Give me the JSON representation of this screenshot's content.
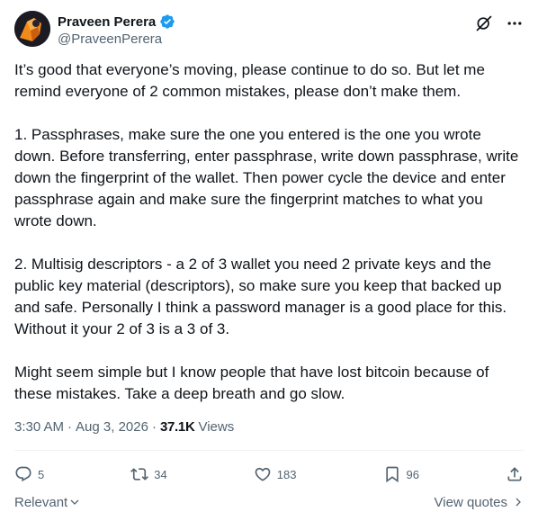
{
  "author": {
    "display_name": "Praveen Perera",
    "handle": "@PraveenPerera",
    "verified": true
  },
  "header_actions": {
    "grok_icon": "grok-icon",
    "more_icon": "more-icon"
  },
  "tweet": {
    "paragraphs": [
      "It’s good that everyone’s moving, please continue to do so. But let me remind everyone of 2 common mistakes, please don’t make them.",
      "1. Passphrases, make sure the one you entered is the one you wrote down. Before transferring, enter passphrase, write down passphrase, write down the fingerprint of the wallet. Then power cycle the device and enter passphrase again and make sure the fingerprint matches to what you wrote down.",
      "2. Multisig descriptors - a 2 of 3 wallet you need 2 private keys and the public key material (descriptors), so make sure you keep that backed up and safe. Personally I think a password manager is a good place for this. Without it your 2 of 3 is a 3 of 3.",
      "Might seem simple but I know people that have lost bitcoin because of these mistakes. Take a deep breath and go slow."
    ]
  },
  "meta": {
    "time": "3:30 AM",
    "date": "Aug 3, 2026",
    "separator": "·",
    "views_count": "37.1K",
    "views_label": "Views"
  },
  "actions": {
    "replies": "5",
    "reposts": "34",
    "likes": "183",
    "bookmarks": "96"
  },
  "footer": {
    "relevant_label": "Relevant",
    "view_quotes_label": "View quotes"
  },
  "colors": {
    "verified_blue": "#1d9bf0",
    "muted": "#536471",
    "text": "#0f1419",
    "divider": "#eff3f4"
  }
}
